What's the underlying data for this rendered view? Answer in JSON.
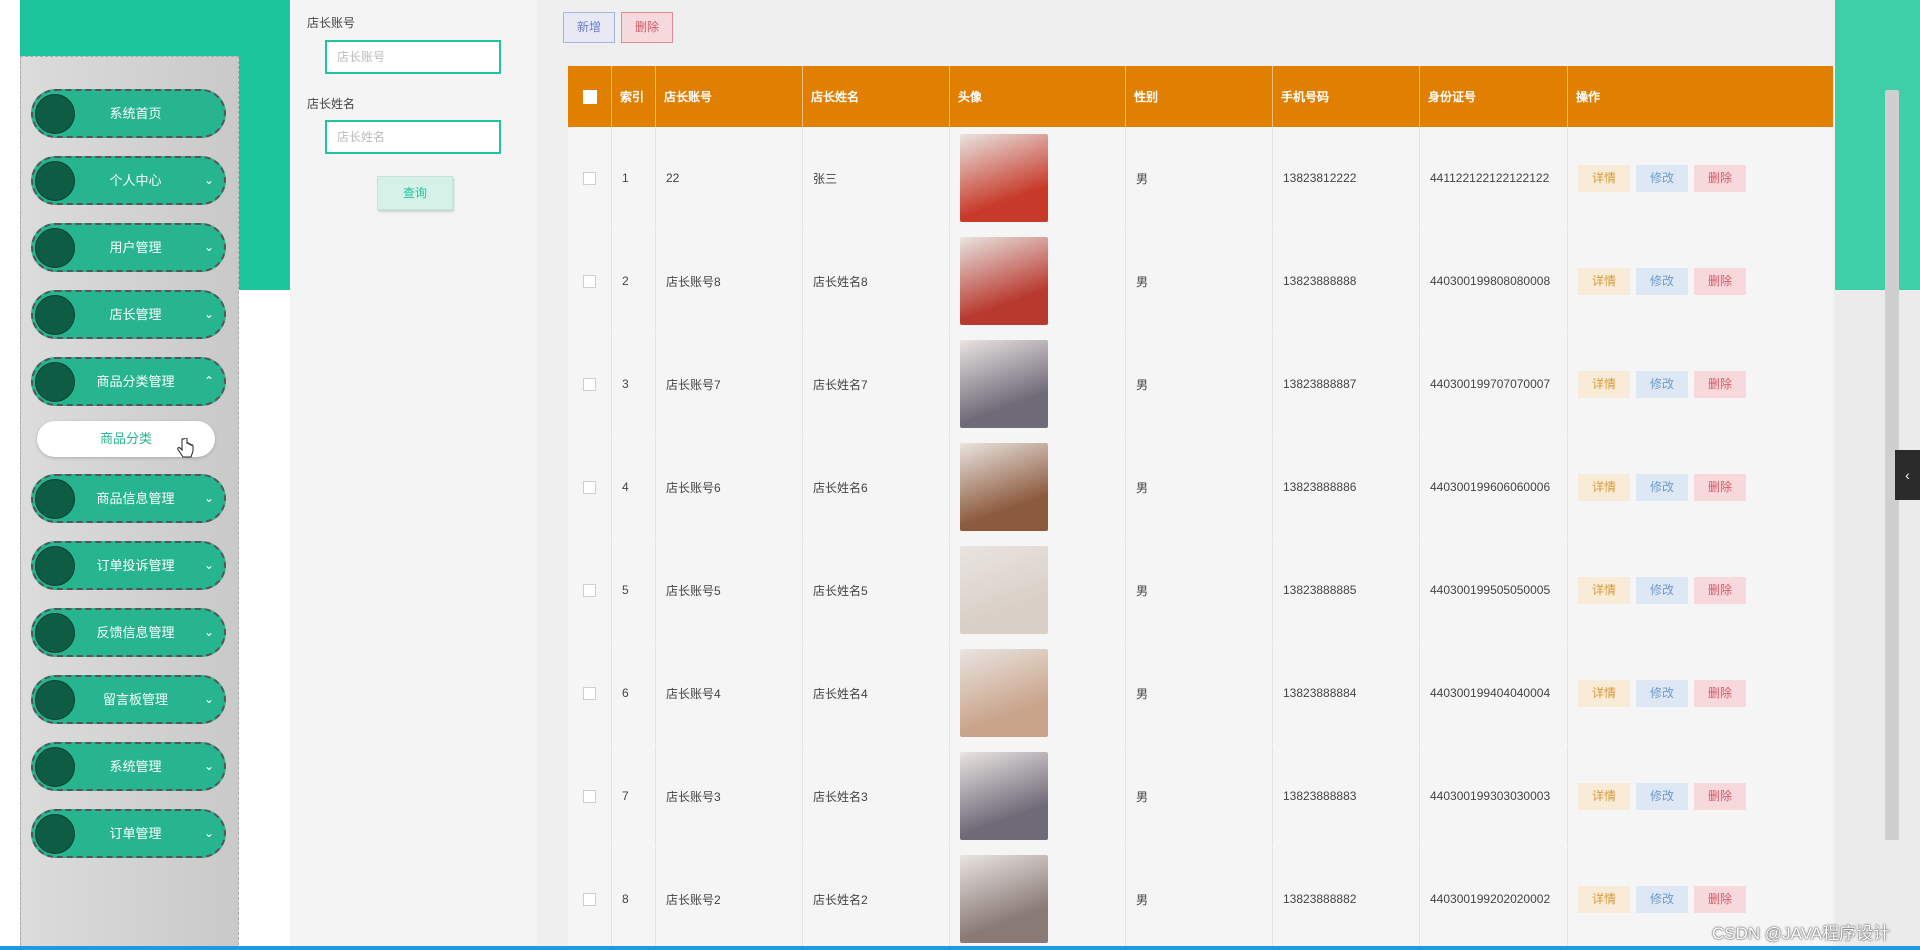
{
  "sidebar": {
    "items": [
      {
        "label": "系统首页",
        "chevron": ""
      },
      {
        "label": "个人中心",
        "chevron": "⌄"
      },
      {
        "label": "用户管理",
        "chevron": "⌄"
      },
      {
        "label": "店长管理",
        "chevron": "⌄"
      },
      {
        "label": "商品分类管理",
        "chevron": "⌃"
      },
      {
        "label": "商品信息管理",
        "chevron": "⌄"
      },
      {
        "label": "订单投诉管理",
        "chevron": "⌄"
      },
      {
        "label": "反馈信息管理",
        "chevron": "⌄"
      },
      {
        "label": "留言板管理",
        "chevron": "⌄"
      },
      {
        "label": "系统管理",
        "chevron": "⌄"
      },
      {
        "label": "订单管理",
        "chevron": "⌄"
      }
    ],
    "submenu": {
      "label": "商品分类"
    }
  },
  "search": {
    "account_label": "店长账号",
    "account_placeholder": "店长账号",
    "name_label": "店长姓名",
    "name_placeholder": "店长姓名",
    "query_button": "查询"
  },
  "toolbar": {
    "add_label": "新增",
    "delete_label": "删除"
  },
  "table": {
    "headers": {
      "index": "索引",
      "account": "店长账号",
      "name": "店长姓名",
      "avatar": "头像",
      "gender": "性别",
      "phone": "手机号码",
      "id_card": "身份证号",
      "actions": "操作"
    },
    "action_labels": {
      "detail": "详情",
      "edit": "修改",
      "delete": "删除"
    },
    "rows": [
      {
        "index": "1",
        "account": "22",
        "name": "张三",
        "gender": "男",
        "phone": "13823812222",
        "id_card": "441122122122122122",
        "avatar_color": "#c73a2a"
      },
      {
        "index": "2",
        "account": "店长账号8",
        "name": "店长姓名8",
        "gender": "男",
        "phone": "13823888888",
        "id_card": "440300199808080008",
        "avatar_color": "#b8392e"
      },
      {
        "index": "3",
        "account": "店长账号7",
        "name": "店长姓名7",
        "gender": "男",
        "phone": "13823888887",
        "id_card": "440300199707070007",
        "avatar_color": "#6f6a78"
      },
      {
        "index": "4",
        "account": "店长账号6",
        "name": "店长姓名6",
        "gender": "男",
        "phone": "13823888886",
        "id_card": "440300199606060006",
        "avatar_color": "#8c5a3c"
      },
      {
        "index": "5",
        "account": "店长账号5",
        "name": "店长姓名5",
        "gender": "男",
        "phone": "13823888885",
        "id_card": "440300199505050005",
        "avatar_color": "#d9cfc6"
      },
      {
        "index": "6",
        "account": "店长账号4",
        "name": "店长姓名4",
        "gender": "男",
        "phone": "13823888884",
        "id_card": "440300199404040004",
        "avatar_color": "#c9a48a"
      },
      {
        "index": "7",
        "account": "店长账号3",
        "name": "店长姓名3",
        "gender": "男",
        "phone": "13823888883",
        "id_card": "440300199303030003",
        "avatar_color": "#6f6a78"
      },
      {
        "index": "8",
        "account": "店长账号2",
        "name": "店长姓名2",
        "gender": "男",
        "phone": "13823888882",
        "id_card": "440300199202020002",
        "avatar_color": "#8a7a76"
      }
    ]
  },
  "watermark": "CSDN @JAVA程序设计"
}
